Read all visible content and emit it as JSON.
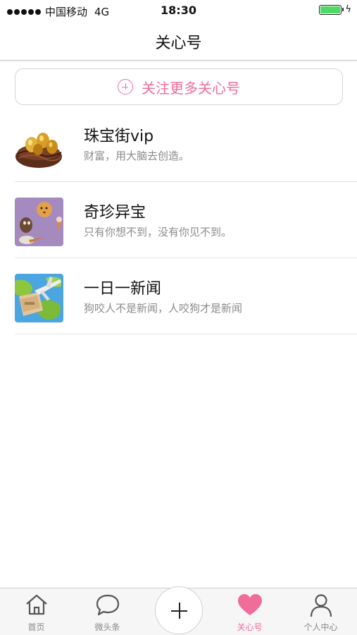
{
  "status_bar": {
    "carrier": "中国移动",
    "network": "4G",
    "time": "18:30",
    "battery_percent": 100
  },
  "nav": {
    "title": "关心号"
  },
  "follow_more": {
    "label": "关注更多关心号",
    "icon": "plus-circle-icon"
  },
  "accounts": [
    {
      "title": "珠宝街vip",
      "desc": "财富，用大脑去创造。",
      "thumb": "gold-eggs-nest"
    },
    {
      "title": "奇珍异宝",
      "desc": "只有你想不到，没有你见不到。",
      "thumb": "food-creatures-purple"
    },
    {
      "title": "一日一新闻",
      "desc": "狗咬人不是新闻，人咬狗才是新闻",
      "thumb": "plane-over-map"
    }
  ],
  "tabs": [
    {
      "label": "首页",
      "icon": "home-icon"
    },
    {
      "label": "微头条",
      "icon": "chat-bubble-icon"
    },
    {
      "label": "",
      "icon": "plus-icon"
    },
    {
      "label": "关心号",
      "icon": "heart-icon",
      "active": true
    },
    {
      "label": "个人中心",
      "icon": "person-icon"
    }
  ],
  "colors": {
    "accent": "#f06d99",
    "battery": "#4cd964",
    "muted_text": "#8a8a8a"
  }
}
